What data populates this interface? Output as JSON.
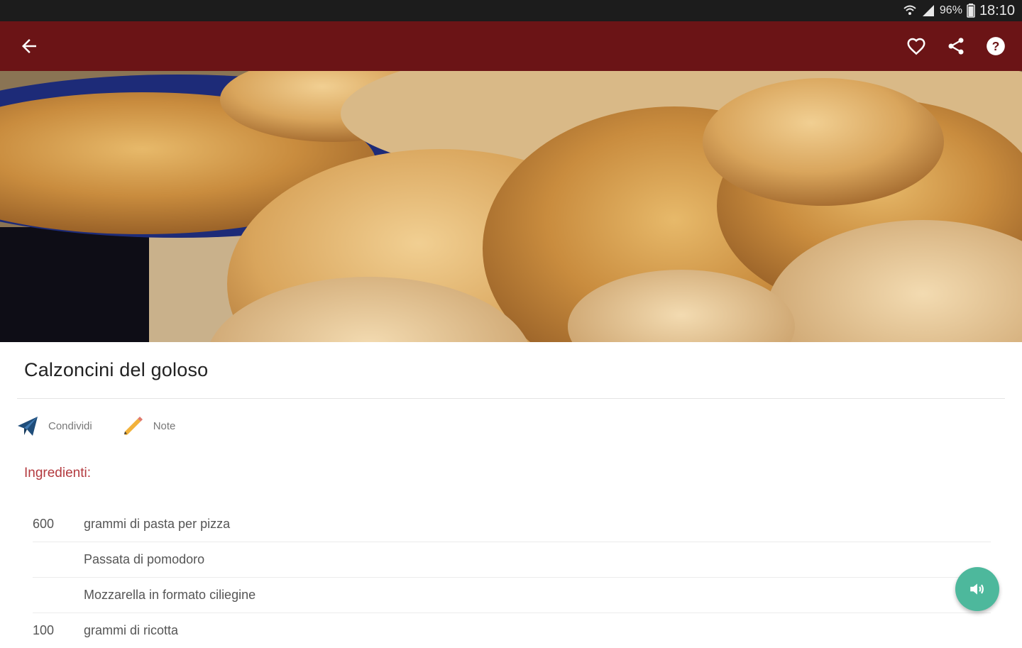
{
  "status_bar": {
    "battery": "96%",
    "time": "18:10"
  },
  "app_bar": {
    "back_icon": "arrow-left-icon",
    "actions": [
      "heart-icon",
      "share-icon",
      "help-icon"
    ]
  },
  "recipe": {
    "title": "Calzoncini del goloso",
    "actions": [
      {
        "label": "Condividi",
        "icon": "paper-plane-icon"
      },
      {
        "label": "Note",
        "icon": "pencil-icon"
      }
    ],
    "ingredients_heading": "Ingredienti:",
    "ingredients": [
      {
        "qty": "600",
        "name": "grammi di pasta per pizza"
      },
      {
        "qty": "",
        "name": "Passata di pomodoro"
      },
      {
        "qty": "",
        "name": "Mozzarella in formato ciliegine"
      },
      {
        "qty": "100",
        "name": "grammi di ricotta"
      }
    ]
  },
  "fab": {
    "icon": "speaker-icon"
  },
  "colors": {
    "app_bar": "#6b1416",
    "accent_text": "#b33a3f",
    "fab": "#4db89c",
    "status_bar": "#1c1c1c"
  }
}
